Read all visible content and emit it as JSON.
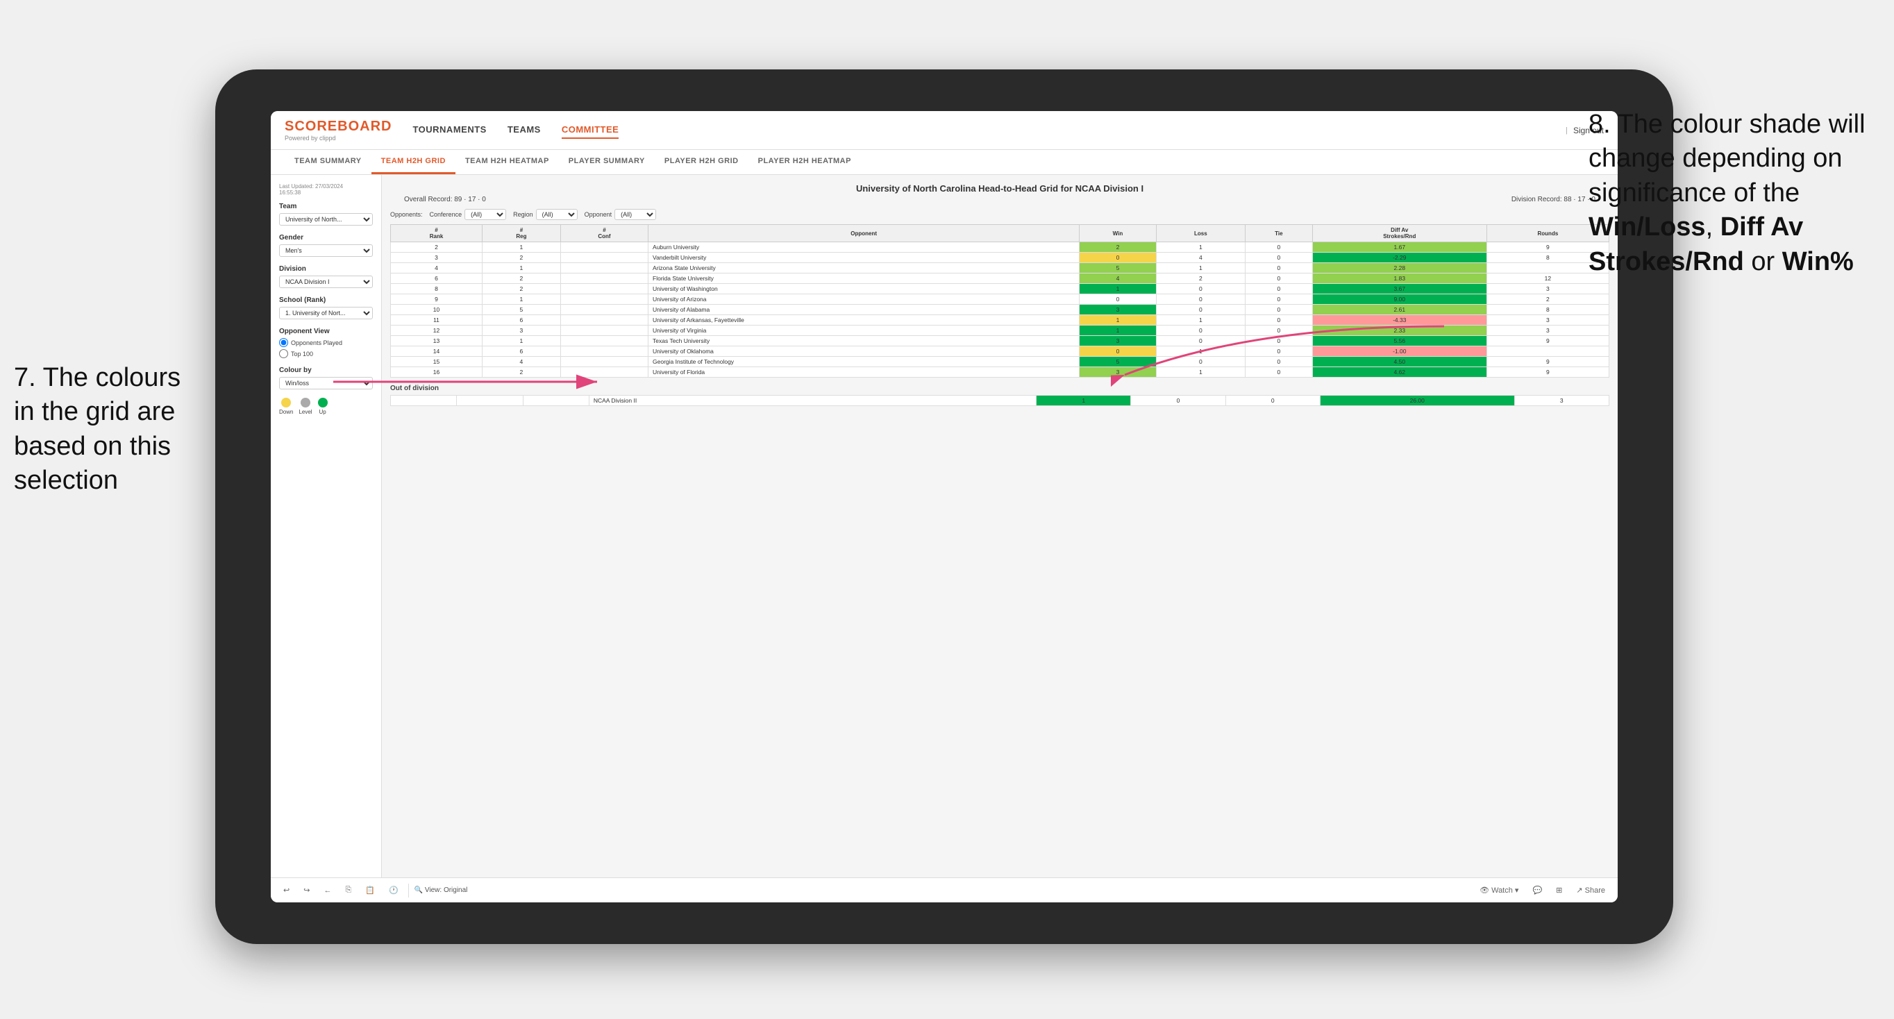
{
  "annotations": {
    "left": "7. The colours in the grid are based on this selection",
    "right_prefix": "8. The colour shade will change depending on significance of the ",
    "right_bold1": "Win/Loss",
    "right_sep1": ", ",
    "right_bold2": "Diff Av Strokes/Rnd",
    "right_sep2": " or ",
    "right_bold3": "Win%"
  },
  "nav": {
    "logo": "SCOREBOARD",
    "logo_sub": "Powered by clippd",
    "links": [
      "TOURNAMENTS",
      "TEAMS",
      "COMMITTEE"
    ],
    "active_link": "COMMITTEE",
    "sign_out": "Sign out"
  },
  "sub_nav": {
    "items": [
      "TEAM SUMMARY",
      "TEAM H2H GRID",
      "TEAM H2H HEATMAP",
      "PLAYER SUMMARY",
      "PLAYER H2H GRID",
      "PLAYER H2H HEATMAP"
    ],
    "active": "TEAM H2H GRID"
  },
  "left_panel": {
    "last_updated_label": "Last Updated: 27/03/2024",
    "last_updated_time": "16:55:38",
    "team_label": "Team",
    "team_value": "University of North...",
    "gender_label": "Gender",
    "gender_value": "Men's",
    "division_label": "Division",
    "division_value": "NCAA Division I",
    "school_rank_label": "School (Rank)",
    "school_rank_value": "1. University of Nort...",
    "opponent_view_label": "Opponent View",
    "opponent_played": "Opponents Played",
    "opponent_top100": "Top 100",
    "colour_by_label": "Colour by",
    "colour_by_value": "Win/loss",
    "legend": {
      "down_label": "Down",
      "level_label": "Level",
      "up_label": "Up",
      "down_color": "#f5d44a",
      "level_color": "#aaaaaa",
      "up_color": "#00b050"
    }
  },
  "grid": {
    "title": "University of North Carolina Head-to-Head Grid for NCAA Division I",
    "overall_record": "Overall Record: 89 · 17 · 0",
    "division_record": "Division Record: 88 · 17 · 0",
    "filters": {
      "opponents_label": "Opponents:",
      "conference_label": "Conference",
      "conference_value": "(All)",
      "region_label": "Region",
      "region_value": "(All)",
      "opponent_label": "Opponent",
      "opponent_value": "(All)"
    },
    "columns": [
      "#\nRank",
      "# Reg",
      "# Conf",
      "Opponent",
      "Win",
      "Loss",
      "Tie",
      "Diff Av\nStrokes/Rnd",
      "Rounds"
    ],
    "rows": [
      {
        "rank": "2",
        "reg": "1",
        "conf": "",
        "opponent": "Auburn University",
        "win": "2",
        "loss": "1",
        "tie": "0",
        "diff": "1.67",
        "rounds": "9",
        "win_color": "cell-green-light",
        "diff_color": "cell-green-light"
      },
      {
        "rank": "3",
        "reg": "2",
        "conf": "",
        "opponent": "Vanderbilt University",
        "win": "0",
        "loss": "4",
        "tie": "0",
        "diff": "-2.29",
        "rounds": "8",
        "win_color": "cell-yellow",
        "diff_color": "cell-green-dark"
      },
      {
        "rank": "4",
        "reg": "1",
        "conf": "",
        "opponent": "Arizona State University",
        "win": "5",
        "loss": "1",
        "tie": "0",
        "diff": "2.28",
        "rounds": "",
        "win_color": "cell-green-light",
        "diff_color": "cell-green-light"
      },
      {
        "rank": "6",
        "reg": "2",
        "conf": "",
        "opponent": "Florida State University",
        "win": "4",
        "loss": "2",
        "tie": "0",
        "diff": "1.83",
        "rounds": "12",
        "win_color": "cell-green-light",
        "diff_color": "cell-green-light"
      },
      {
        "rank": "8",
        "reg": "2",
        "conf": "",
        "opponent": "University of Washington",
        "win": "1",
        "loss": "0",
        "tie": "0",
        "diff": "3.67",
        "rounds": "3",
        "win_color": "cell-green-dark",
        "diff_color": "cell-green-dark"
      },
      {
        "rank": "9",
        "reg": "1",
        "conf": "",
        "opponent": "University of Arizona",
        "win": "0",
        "loss": "0",
        "tie": "0",
        "diff": "9.00",
        "rounds": "2",
        "win_color": "",
        "diff_color": "cell-green-dark"
      },
      {
        "rank": "10",
        "reg": "5",
        "conf": "",
        "opponent": "University of Alabama",
        "win": "3",
        "loss": "0",
        "tie": "0",
        "diff": "2.61",
        "rounds": "8",
        "win_color": "cell-green-dark",
        "diff_color": "cell-green-light"
      },
      {
        "rank": "11",
        "reg": "6",
        "conf": "",
        "opponent": "University of Arkansas, Fayetteville",
        "win": "1",
        "loss": "1",
        "tie": "0",
        "diff": "-4.33",
        "rounds": "3",
        "win_color": "cell-yellow",
        "diff_color": "cell-red-light"
      },
      {
        "rank": "12",
        "reg": "3",
        "conf": "",
        "opponent": "University of Virginia",
        "win": "1",
        "loss": "0",
        "tie": "0",
        "diff": "2.33",
        "rounds": "3",
        "win_color": "cell-green-dark",
        "diff_color": "cell-green-light"
      },
      {
        "rank": "13",
        "reg": "1",
        "conf": "",
        "opponent": "Texas Tech University",
        "win": "3",
        "loss": "0",
        "tie": "0",
        "diff": "5.56",
        "rounds": "9",
        "win_color": "cell-green-dark",
        "diff_color": "cell-green-dark"
      },
      {
        "rank": "14",
        "reg": "6",
        "conf": "",
        "opponent": "University of Oklahoma",
        "win": "0",
        "loss": "1",
        "tie": "0",
        "diff": "-1.00",
        "rounds": "",
        "win_color": "cell-yellow",
        "diff_color": "cell-red-light"
      },
      {
        "rank": "15",
        "reg": "4",
        "conf": "",
        "opponent": "Georgia Institute of Technology",
        "win": "5",
        "loss": "0",
        "tie": "0",
        "diff": "4.50",
        "rounds": "9",
        "win_color": "cell-green-dark",
        "diff_color": "cell-green-dark"
      },
      {
        "rank": "16",
        "reg": "2",
        "conf": "",
        "opponent": "University of Florida",
        "win": "3",
        "loss": "1",
        "tie": "0",
        "diff": "4.62",
        "rounds": "9",
        "win_color": "cell-green-light",
        "diff_color": "cell-green-dark"
      }
    ],
    "out_of_division_label": "Out of division",
    "out_rows": [
      {
        "opponent": "NCAA Division II",
        "win": "1",
        "loss": "0",
        "tie": "0",
        "diff": "26.00",
        "rounds": "3",
        "win_color": "cell-green-dark",
        "diff_color": "cell-green-dark"
      }
    ]
  },
  "toolbar": {
    "view_label": "View: Original",
    "watch_label": "Watch",
    "share_label": "Share"
  }
}
